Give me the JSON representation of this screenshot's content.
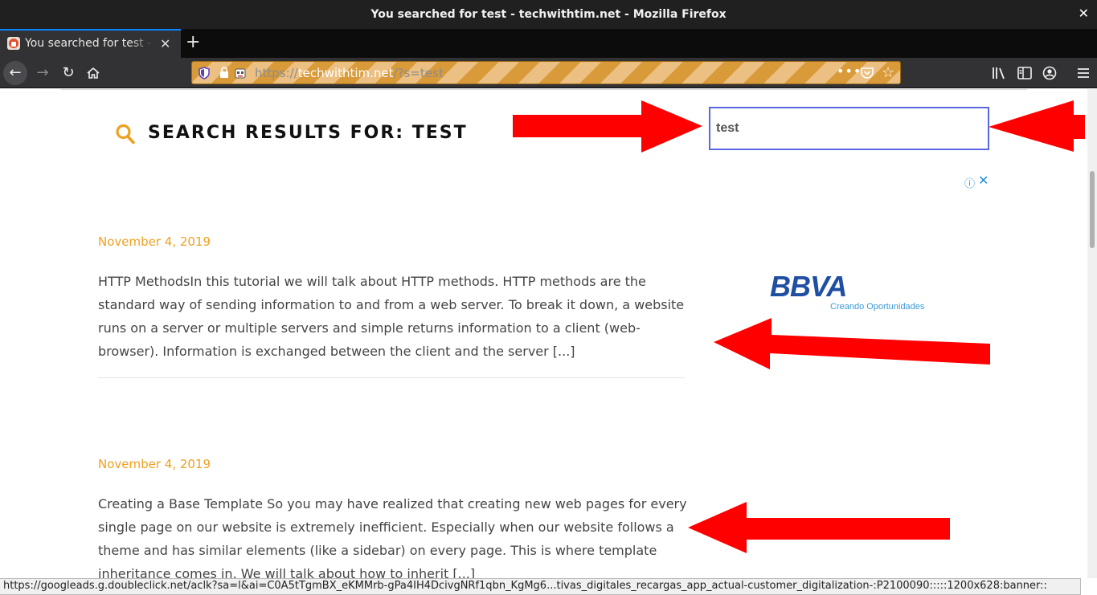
{
  "window": {
    "title": "You searched for test - techwithtim.net - Mozilla Firefox",
    "close_glyph": "✕"
  },
  "tabs": [
    {
      "label": "You searched for test - techwithtim.net",
      "close_glyph": "✕"
    }
  ],
  "new_tab_glyph": "+",
  "nav": {
    "back_glyph": "←",
    "forward_glyph": "→",
    "reload_glyph": "↻",
    "url_prefix": "https://",
    "url_host": "techwithtim.net",
    "url_path": "/?s=test",
    "page_actions_glyph": "•••",
    "bookmark_glyph": "☆"
  },
  "page": {
    "heading": "SEARCH RESULTS FOR: TEST",
    "search": {
      "value": "test"
    },
    "ad": {
      "info_glyph": "ⓘ",
      "close_glyph": "✕",
      "brand": "BBVA",
      "tagline": "Creando Oportunidades"
    },
    "posts": [
      {
        "date": "November 4, 2019",
        "excerpt": "HTTP MethodsIn this tutorial we will talk about HTTP methods. HTTP methods are the standard way of sending information to and from a web server. To break it down, a website runs on a server or multiple servers and simple returns information to a client (web-browser). Information is exchanged between the client and the server [...]"
      },
      {
        "date": "November 4, 2019",
        "excerpt": "Creating a Base Template So you may have realized that creating new web pages for every single page on our website is extremely inefficient. Especially when our website follows a theme and has similar elements (like a sidebar) on every page. This is where template inheritance comes in. We will talk about how to inherit [...]"
      }
    ]
  },
  "status_url": "https://googleads.g.doubleclick.net/aclk?sa=l&ai=C0A5tTgmBX_eKMMrb-gPa4IH4DcivgNRf1qbn_KgMg6...tivas_digitales_recargas_app_actual-customer_digitalization-:P2100090:::::1200x628:banner::",
  "colors": {
    "accent_orange": "#f0a020",
    "annotation_red": "#ff0000",
    "search_border": "#5a68e0",
    "ad_blue": "#1f4ea3"
  }
}
